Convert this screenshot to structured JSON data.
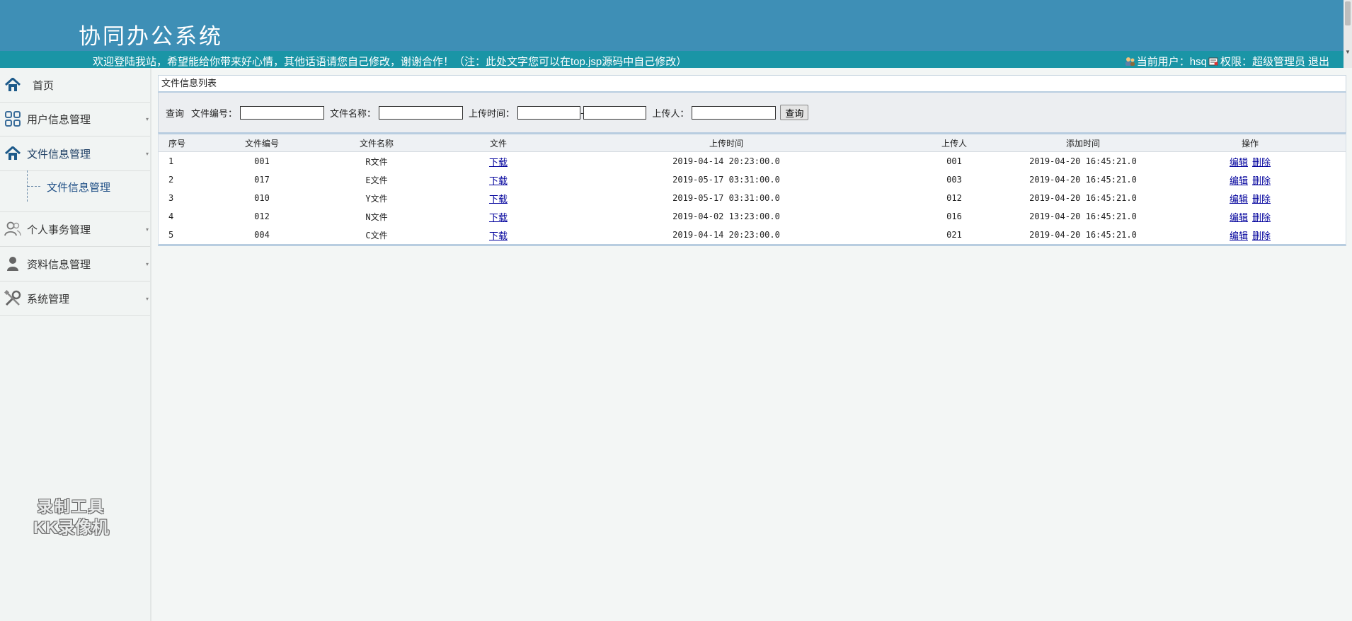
{
  "header": {
    "title": "协同办公系统",
    "welcome": "欢迎登陆我站，希望能给你带来好心情，其他话语请您自己修改，谢谢合作！（注：此处文字您可以在top.jsp源码中自己修改）",
    "current_user_label": "当前用户：hsq",
    "permission_label": "权限：超级管理员",
    "logout": "退出"
  },
  "sidebar": {
    "items": [
      {
        "label": "首页",
        "icon": "home-icon"
      },
      {
        "label": "用户信息管理",
        "icon": "grid-icon"
      },
      {
        "label": "文件信息管理",
        "icon": "home-icon"
      },
      {
        "label": "个人事务管理",
        "icon": "users-icon"
      },
      {
        "label": "资料信息管理",
        "icon": "person-icon"
      },
      {
        "label": "系统管理",
        "icon": "tools-icon"
      }
    ],
    "submenu": {
      "label": "文件信息管理"
    }
  },
  "watermark": {
    "line1": "录制工具",
    "line2": "KK录像机"
  },
  "panel": {
    "title": "文件信息列表"
  },
  "search": {
    "prefix": "查询",
    "file_no_label": "文件编号：",
    "file_name_label": "文件名称：",
    "upload_time_label": "上传时间：",
    "range_sep": "-",
    "uploader_label": "上传人：",
    "button": "查询",
    "file_no_value": "",
    "file_name_value": "",
    "upload_start_value": "",
    "upload_end_value": "",
    "uploader_value": ""
  },
  "table": {
    "headers": [
      "序号",
      "文件编号",
      "文件名称",
      "文件",
      "上传时间",
      "上传人",
      "添加时间",
      "操作"
    ],
    "download_label": "下载",
    "edit_label": "编辑",
    "delete_label": "删除",
    "rows": [
      {
        "idx": "1",
        "no": "001",
        "name": "R文件",
        "upload_time": "2019-04-14 20:23:00.0",
        "uploader": "001",
        "add_time": "2019-04-20 16:45:21.0"
      },
      {
        "idx": "2",
        "no": "017",
        "name": "E文件",
        "upload_time": "2019-05-17 03:31:00.0",
        "uploader": "003",
        "add_time": "2019-04-20 16:45:21.0"
      },
      {
        "idx": "3",
        "no": "010",
        "name": "Y文件",
        "upload_time": "2019-05-17 03:31:00.0",
        "uploader": "012",
        "add_time": "2019-04-20 16:45:21.0"
      },
      {
        "idx": "4",
        "no": "012",
        "name": "N文件",
        "upload_time": "2019-04-02 13:23:00.0",
        "uploader": "016",
        "add_time": "2019-04-20 16:45:21.0"
      },
      {
        "idx": "5",
        "no": "004",
        "name": "C文件",
        "upload_time": "2019-04-14 20:23:00.0",
        "uploader": "021",
        "add_time": "2019-04-20 16:45:21.0"
      }
    ]
  },
  "colors": {
    "header_bg": "#3e8fb6",
    "welcome_bg": "#1a95a6",
    "link": "#00009c"
  }
}
